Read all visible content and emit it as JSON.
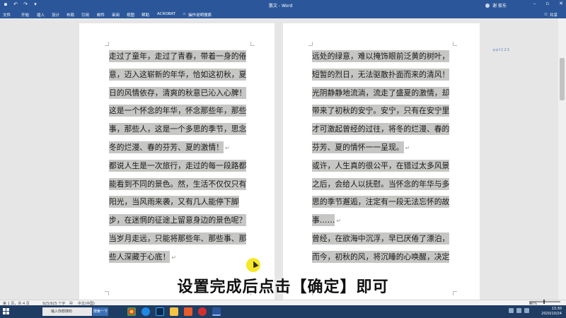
{
  "window": {
    "title": "散文 - Word",
    "user_name": "谢 俊东",
    "quick_access": [
      "save-icon",
      "undo-icon",
      "redo-icon",
      "customize-icon"
    ],
    "controls": [
      "minimize",
      "maximize",
      "close"
    ]
  },
  "menu": {
    "items": [
      "文件",
      "开始",
      "插入",
      "设计",
      "布局",
      "引用",
      "邮件",
      "审阅",
      "视图",
      "帮助",
      "ACROBAT",
      "操作说明搜索"
    ],
    "share": "共享"
  },
  "document": {
    "left_page_lines": [
      {
        "text": "走过了童年，走过了青春，带着一身的倦",
        "mark": ""
      },
      {
        "text": "意，迈入这崭新的年华，恰如这初秋，夏",
        "mark": ""
      },
      {
        "text": "日的风情依存，清爽的秋意已沁入心脾！",
        "mark": ""
      },
      {
        "text": "这是一个怀念的年华，怀念那些年，那些",
        "mark": ""
      },
      {
        "text": "事，那些人，这是一个多思的季节，思念",
        "mark": ""
      },
      {
        "text": "冬的烂漫、春的芬芳、夏的激情！",
        "mark": "↵"
      },
      {
        "text": "都说人生是一次旅行，走过的每一段路都",
        "mark": ""
      },
      {
        "text": "能看到不同的景色。然，生活不仅仅只有",
        "mark": ""
      },
      {
        "text": "阳光，当风雨来袭，又有几人能停下脚",
        "mark": ""
      },
      {
        "text": "步，在迷惘的征途上留意身边的景色呢？",
        "mark": ""
      },
      {
        "text": "当岁月走远，只能将那些年、那些事、那",
        "mark": ""
      },
      {
        "text": "些人深藏于心底！",
        "mark": "↵"
      }
    ],
    "right_page_lines": [
      {
        "text": "远处的绿意，难以掩饰眼前泛黄的树叶，",
        "mark": ""
      },
      {
        "text": "短暂的烈日，无法驱散扑面而来的清风！",
        "mark": ""
      },
      {
        "text": "光阴静静地流淌，流走了盛夏的激情，却",
        "mark": ""
      },
      {
        "text": "带来了初秋的安宁。安宁，只有在安宁里",
        "mark": ""
      },
      {
        "text": "才可激起曾经的过往，将冬的烂漫、春的",
        "mark": ""
      },
      {
        "text": "芬芳、夏的情怀一一呈现。",
        "mark": "↵"
      },
      {
        "text": "或许，人生真的很公平，在错过太多风景",
        "mark": ""
      },
      {
        "text": "之后，会给人以抚慰。当怀念的年华与多",
        "mark": ""
      },
      {
        "text": "思的季节邂逅，注定有一段无法忘怀的故",
        "mark": ""
      },
      {
        "text": "事……",
        "mark": "↵"
      },
      {
        "text": "曾经，在欲海中沉浮，早已厌倦了漂泊，",
        "mark": ""
      },
      {
        "text": "而今，初秋的风，将沉睡的心唤醒，决定",
        "mark": ""
      }
    ],
    "highlight_color": "#c6c6c4",
    "logo_text": "ppt123"
  },
  "caption": "设置完成后点击【确定】即可",
  "statusbar": {
    "page": "第 1 页，共 4 页",
    "words": "925/925 个字",
    "language": "中文(中国)",
    "zoom": "85%"
  },
  "taskbar": {
    "search_placeholder": "输入你想搜的",
    "search_button": "搜索一下",
    "time": "13:30",
    "date": "2020/10/24",
    "apps": [
      "chrome-icon",
      "edge-icon",
      "photoshop-icon",
      "folder-icon",
      "media-icon",
      "record-icon",
      "word-icon"
    ]
  }
}
